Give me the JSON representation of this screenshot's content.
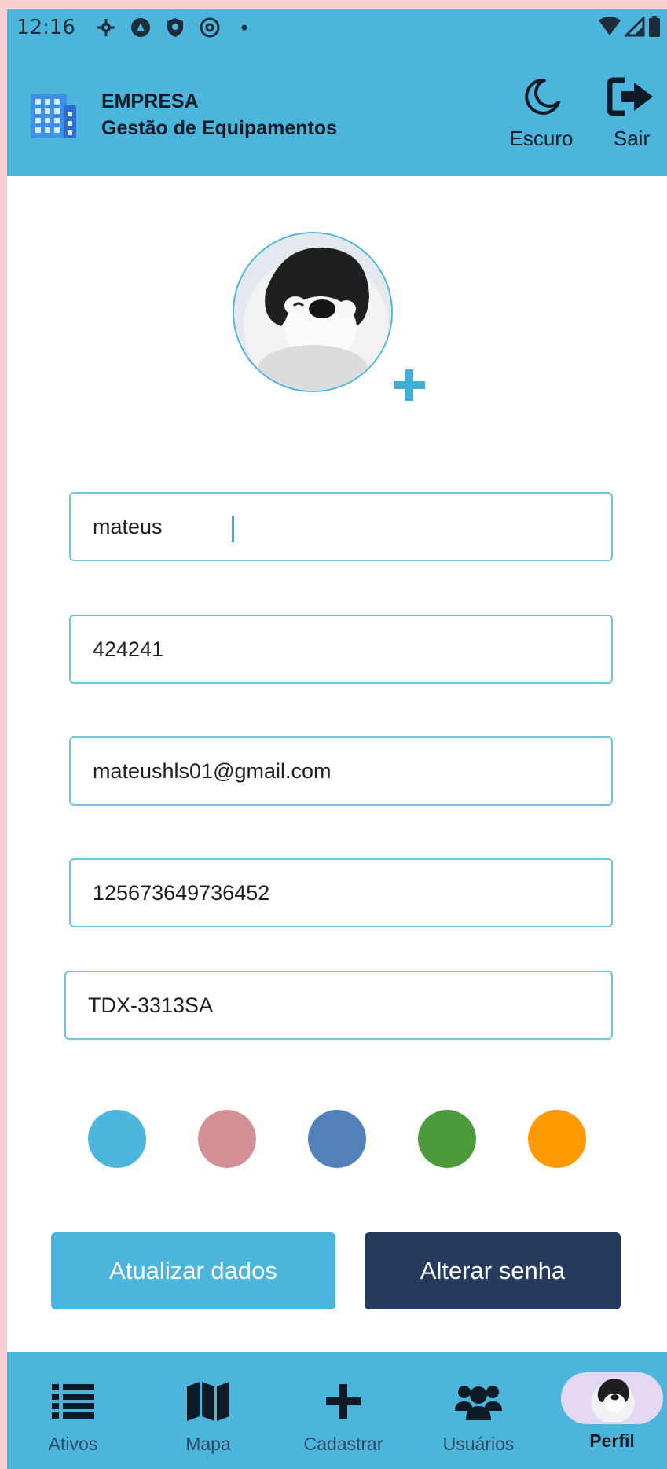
{
  "status_bar": {
    "time": "12:16"
  },
  "header": {
    "company": "EMPRESA",
    "subtitle": "Gestão de Equipamentos",
    "dark_mode_label": "Escuro",
    "logout_label": "Sair"
  },
  "profile": {
    "fields": [
      {
        "value": "mateus"
      },
      {
        "value": "424241"
      },
      {
        "value": "mateushls01@gmail.com"
      },
      {
        "value": "125673649736452"
      },
      {
        "value": "TDX-3313SA"
      }
    ],
    "theme_colors": [
      "#4cb5db",
      "#d28f95",
      "#5280ba",
      "#4b9a3c",
      "#ff9a00"
    ],
    "update_button": "Atualizar dados",
    "change_password_button": "Alterar senha"
  },
  "bottom_nav": {
    "items": [
      {
        "label": "Ativos",
        "icon": "list-icon"
      },
      {
        "label": "Mapa",
        "icon": "map-icon"
      },
      {
        "label": "Cadastrar",
        "icon": "plus-icon"
      },
      {
        "label": "Usuários",
        "icon": "users-icon"
      },
      {
        "label": "Perfil",
        "icon": "avatar"
      }
    ],
    "active": "Perfil"
  },
  "colors": {
    "primary": "#4cb5db",
    "dark_button": "#263a5e",
    "page_bg": "#f8cfd0",
    "field_border": "#6fc3e3"
  }
}
